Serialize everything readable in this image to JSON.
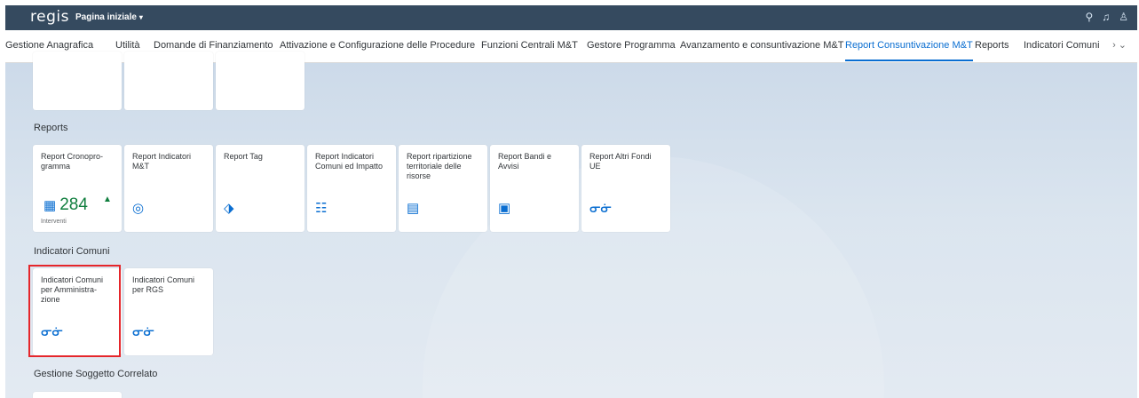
{
  "shell": {
    "logo": "regis",
    "home_title": "Pagina iniziale",
    "home_caret": "▾",
    "icons": [
      "search-icon",
      "bell-icon",
      "user-icon"
    ]
  },
  "nav": {
    "items": [
      "Gestione Anagrafica",
      "Utilità",
      "Domande di Finanziamento",
      "Attivazione e Configurazione delle Procedure",
      "Funzioni Centrali M&T",
      "Gestore Programma",
      "Avanzamento e consuntivazione M&T",
      "Report Consuntivazione M&T",
      "Reports",
      "Indicatori Comuni"
    ],
    "active_index": 7,
    "more": "›  ⌄"
  },
  "sections": {
    "reports_title": "Reports",
    "indicatori_title": "Indicatori Comuni",
    "gestione_title": "Gestione Soggetto Correlato"
  },
  "reports_tiles": [
    {
      "title": "Report Cronopro-gramma",
      "kpi": "284",
      "kpi_icon": "grid-chart-icon",
      "trend": "up",
      "footer": "Interventi"
    },
    {
      "title": "Report Indicatori M&T",
      "icon": "target-icon"
    },
    {
      "title": "Report Tag",
      "icon": "tag-icon"
    },
    {
      "title": "Report Indicatori Comuni ed Impatto",
      "icon": "checklist-icon"
    },
    {
      "title": "Report ripartizione territoriale delle risorse",
      "icon": "document-money-icon"
    },
    {
      "title": "Report Bandi e Avvisi",
      "icon": "form-icon"
    },
    {
      "title": "Report Altri Fondi UE",
      "icon": "glasses-icon"
    }
  ],
  "indicatori_tiles": [
    {
      "title": "Indicatori Comuni per Amministra-zione",
      "icon": "glasses-icon",
      "highlighted": true
    },
    {
      "title": "Indicatori Comuni per RGS",
      "icon": "glasses-icon"
    }
  ],
  "glyphs": {
    "search": "⚲",
    "bell": "♫",
    "user": "♙",
    "target": "◎",
    "tag": "⬗",
    "checklist": "☷",
    "document_money": "▤",
    "form": "▣",
    "glasses": "ᓂᓃ",
    "grid": "▦",
    "tri_up": "▲"
  },
  "colors": {
    "shell_bar": "#354a5f",
    "accent": "#0a6ed1",
    "positive": "#107e3e",
    "highlight": "#e5262b"
  }
}
